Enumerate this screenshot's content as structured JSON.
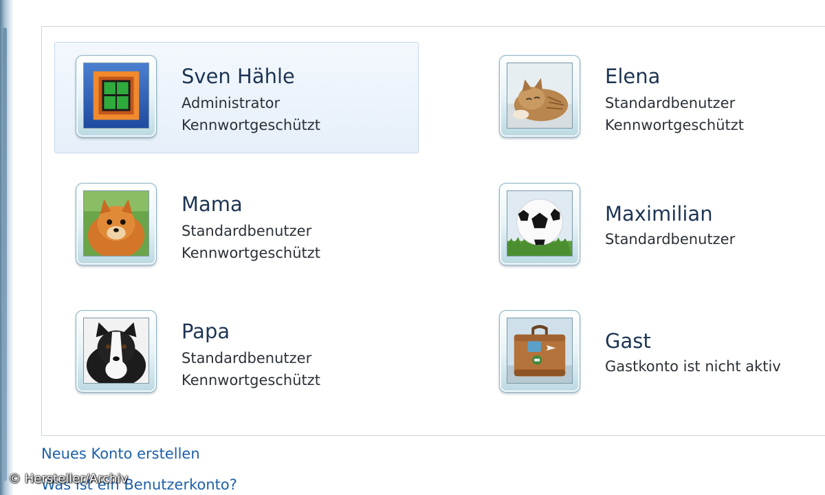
{
  "header": {
    "title_fragment": ""
  },
  "accounts": [
    {
      "name": "Sven Hähle",
      "type": "Administrator",
      "status": "Kennwortgeschützt",
      "icon": "windows-logo-icon"
    },
    {
      "name": "Elena",
      "type": "Standardbenutzer",
      "status": "Kennwortgeschützt",
      "icon": "kitten-icon"
    },
    {
      "name": "Mama",
      "type": "Standardbenutzer",
      "status": "Kennwortgeschützt",
      "icon": "pomeranian-dog-icon"
    },
    {
      "name": "Maximilian",
      "type": "Standardbenutzer",
      "status": "",
      "icon": "soccer-ball-icon"
    },
    {
      "name": "Papa",
      "type": "Standardbenutzer",
      "status": "Kennwortgeschützt",
      "icon": "border-collie-icon"
    },
    {
      "name": "Gast",
      "type": "Gastkonto ist nicht aktiv",
      "status": "",
      "icon": "suitcase-icon"
    }
  ],
  "links": {
    "create_account": "Neues Konto erstellen",
    "what_is_account": "Was ist ein Benutzerkonto?"
  },
  "credit": "© Hersteller/Archiv",
  "colors": {
    "link": "#1d5fa8",
    "name": "#1e3553",
    "selection": "#e6eff9"
  }
}
